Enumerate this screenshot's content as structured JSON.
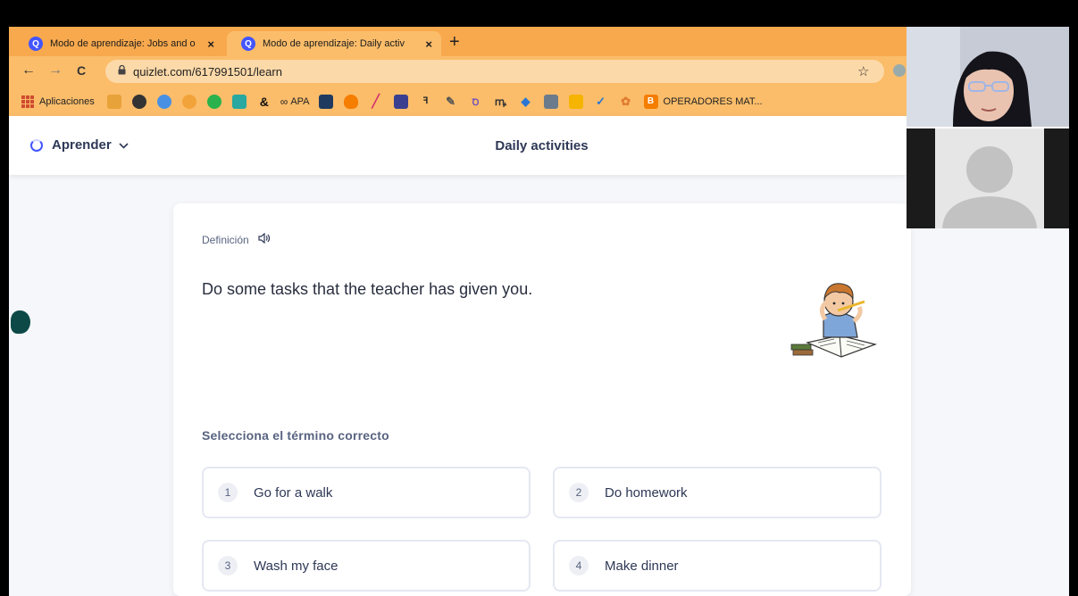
{
  "browser": {
    "tabs": [
      {
        "favicon": "Q",
        "title": "Modo de aprendizaje: Jobs and o",
        "close": "×",
        "active": false
      },
      {
        "favicon": "Q",
        "title": "Modo de aprendizaje: Daily activ",
        "close": "×",
        "active": true
      }
    ],
    "new_tab": "+",
    "nav": {
      "back": "←",
      "forward": "→",
      "reload": "C"
    },
    "url": "quizlet.com/617991501/learn",
    "star": "☆",
    "bookmarks": {
      "apps_label": "Aplicaciones",
      "apa_label": "APA",
      "last_label": "OPERADORES MAT..."
    }
  },
  "app": {
    "mode_label": "Aprender",
    "set_title": "Daily activities"
  },
  "card": {
    "definition_label": "Definición",
    "speaker_glyph": "🔈",
    "definition_text": "Do some tasks that the teacher has given you.",
    "prompt": "Selecciona el término correcto",
    "options": [
      {
        "num": "1",
        "label": "Go for a walk"
      },
      {
        "num": "2",
        "label": "Do homework"
      },
      {
        "num": "3",
        "label": "Wash my face"
      },
      {
        "num": "4",
        "label": "Make dinner"
      }
    ]
  },
  "colors": {
    "tab_strip": "#f8a94d",
    "toolbar": "#fbbd6a",
    "quizlet_blue": "#4255ff",
    "page_bg": "#f6f7fb"
  }
}
